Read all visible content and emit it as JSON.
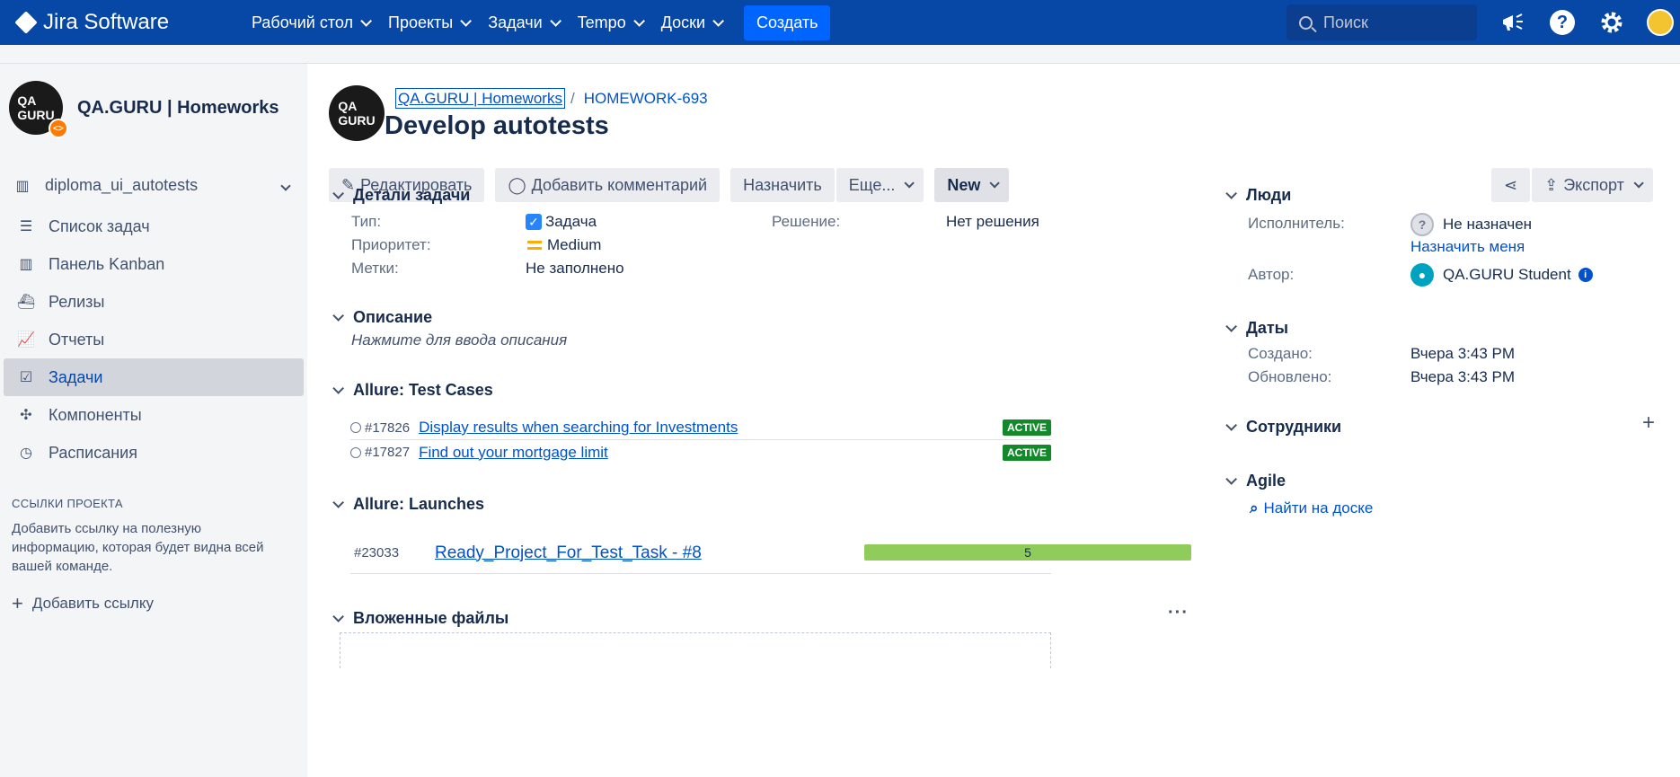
{
  "topbar": {
    "app_name": "Jira Software",
    "nav": [
      "Рабочий стол",
      "Проекты",
      "Задачи",
      "Tempo",
      "Доски"
    ],
    "create_label": "Создать",
    "search_placeholder": "Поиск"
  },
  "sidebar": {
    "project_name": "QA.GURU | Homeworks",
    "board_name": "diploma_ui_autotests",
    "items": [
      {
        "label": "Список задач",
        "icon": "backlog-icon"
      },
      {
        "label": "Панель Kanban",
        "icon": "board-icon"
      },
      {
        "label": "Релизы",
        "icon": "ship-icon"
      },
      {
        "label": "Отчеты",
        "icon": "chart-icon"
      },
      {
        "label": "Задачи",
        "icon": "issues-icon",
        "active": true
      },
      {
        "label": "Компоненты",
        "icon": "puzzle-icon"
      },
      {
        "label": "Расписания",
        "icon": "clock-icon"
      }
    ],
    "links_section_title": "ССЫЛКИ ПРОЕКТА",
    "links_text": "Добавить ссылку на полезную информацию, которая будет видна всей вашей команде.",
    "add_link_label": "Добавить ссылку"
  },
  "issue": {
    "breadcrumb_project": "QA.GURU | Homeworks",
    "breadcrumb_key": "HOMEWORK-693",
    "summary": "Develop autotests"
  },
  "toolbar": {
    "edit": "Редактировать",
    "comment": "Добавить комментарий",
    "assign": "Назначить",
    "more": "Еще...",
    "status": "New",
    "export": "Экспорт"
  },
  "details": {
    "title": "Детали задачи",
    "type_label": "Тип:",
    "type_value": "Задача",
    "priority_label": "Приоритет:",
    "priority_value": "Medium",
    "labels_label": "Метки:",
    "labels_value": "Не заполнено",
    "resolution_label": "Решение:",
    "resolution_value": "Нет решения"
  },
  "description": {
    "title": "Описание",
    "placeholder": "Нажмите для ввода описания"
  },
  "test_cases": {
    "title": "Allure: Test Cases",
    "rows": [
      {
        "id": "#17826",
        "name": "Display results when searching for Investments",
        "status": "ACTIVE"
      },
      {
        "id": "#17827",
        "name": "Find out your mortgage limit",
        "status": "ACTIVE"
      }
    ]
  },
  "launches": {
    "title": "Allure: Launches",
    "rows": [
      {
        "id": "#23033",
        "name": "Ready_Project_For_Test_Task - #8",
        "count": "5"
      }
    ]
  },
  "attachments": {
    "title": "Вложенные файлы"
  },
  "people": {
    "title": "Люди",
    "assignee_label": "Исполнитель:",
    "assignee_value": "Не назначен",
    "assign_me": "Назначить меня",
    "reporter_label": "Автор:",
    "reporter_value": "QA.GURU Student"
  },
  "dates": {
    "title": "Даты",
    "created_label": "Создано:",
    "created_value": "Вчера 3:43 PM",
    "updated_label": "Обновлено:",
    "updated_value": "Вчера 3:43 PM"
  },
  "staff": {
    "title": "Сотрудники"
  },
  "agile": {
    "title": "Agile",
    "find_on_board": "Найти на доске"
  },
  "colors": {
    "topbar": "#0747a6",
    "create": "#0065ff",
    "active_badge": "#14892c",
    "launch_bar": "#8fcc5c"
  }
}
